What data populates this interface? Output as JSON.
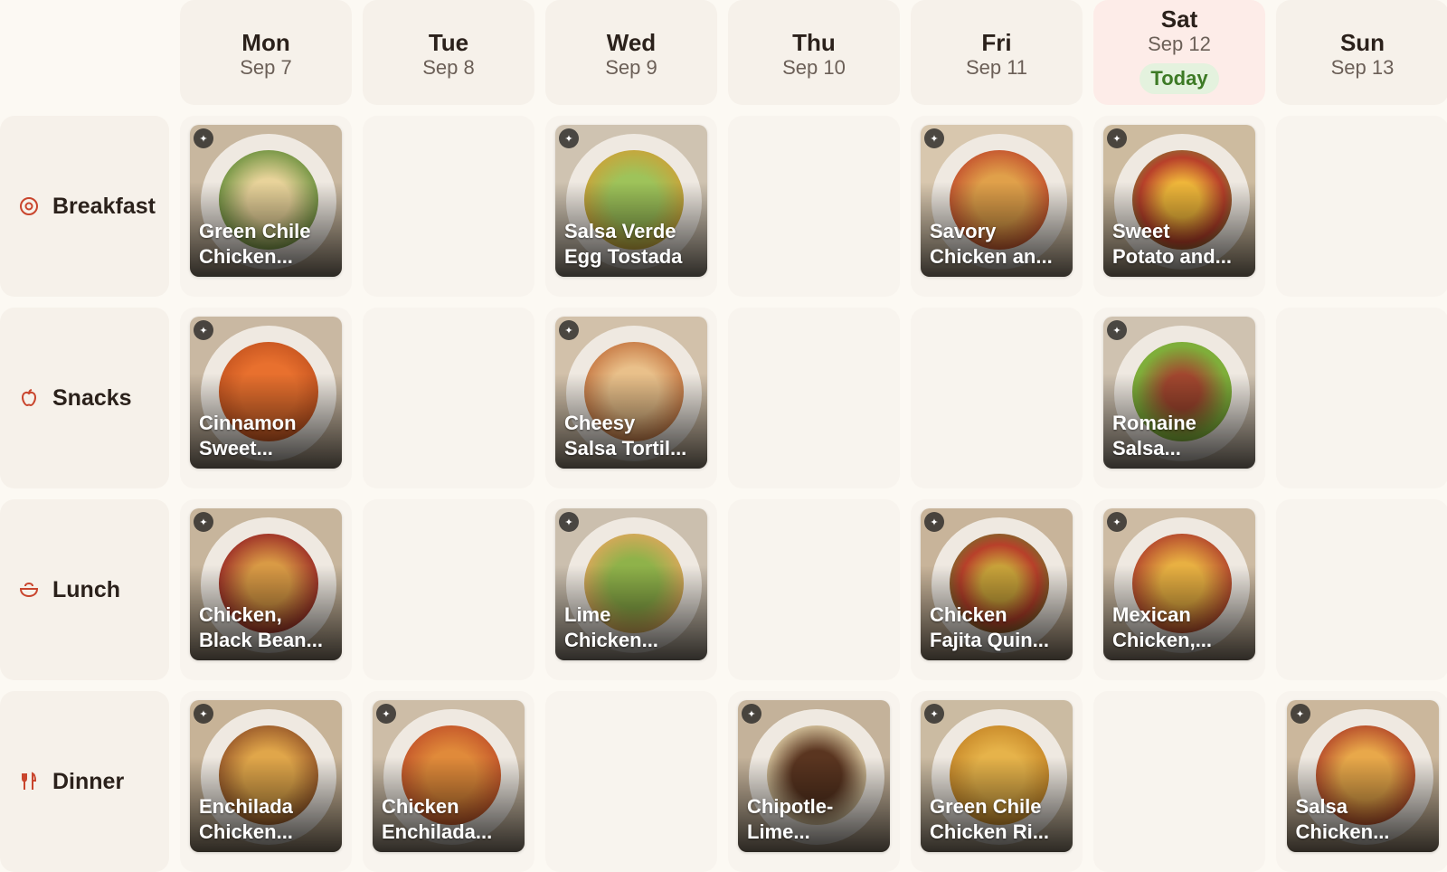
{
  "days": [
    {
      "name": "Mon",
      "date": "Sep 7"
    },
    {
      "name": "Tue",
      "date": "Sep 8"
    },
    {
      "name": "Wed",
      "date": "Sep 9"
    },
    {
      "name": "Thu",
      "date": "Sep 10"
    },
    {
      "name": "Fri",
      "date": "Sep 11"
    },
    {
      "name": "Sat",
      "date": "Sep 12",
      "badge": "Today"
    },
    {
      "name": "Sun",
      "date": "Sep 13"
    }
  ],
  "meals": [
    {
      "label": "Breakfast",
      "icon": "egg-icon",
      "color": "#c9452d"
    },
    {
      "label": "Snacks",
      "icon": "apple-icon",
      "color": "#c9452d"
    },
    {
      "label": "Lunch",
      "icon": "bowl-icon",
      "color": "#c9452d"
    },
    {
      "label": "Dinner",
      "icon": "fork-knife-icon",
      "color": "#c9452d"
    }
  ],
  "recipes": {
    "breakfast": [
      "Green Chile\nChicken...",
      "",
      "Salsa Verde\nEgg Tostada",
      "",
      "Savory\nChicken an...",
      "Sweet\nPotato and...",
      ""
    ],
    "snacks": [
      "Cinnamon\nSweet...",
      "",
      "Cheesy\nSalsa Tortil...",
      "",
      "",
      "Romaine\nSalsa...",
      ""
    ],
    "lunch": [
      "Chicken,\nBlack Bean...",
      "",
      "Lime\nChicken...",
      "",
      "Chicken\nFajita Quin...",
      "Mexican\nChicken,...",
      ""
    ],
    "dinner": [
      "Enchilada\nChicken...",
      "Chicken\nEnchilada...",
      "",
      "Chipotle-\nLime...",
      "Green Chile\nChicken Ri...",
      "",
      "Salsa\nChicken..."
    ]
  },
  "colors": {
    "today_header": "#fdece8",
    "today_badge_bg": "#e4f2de",
    "today_badge_text": "#3d7a25",
    "accent": "#c9452d"
  }
}
